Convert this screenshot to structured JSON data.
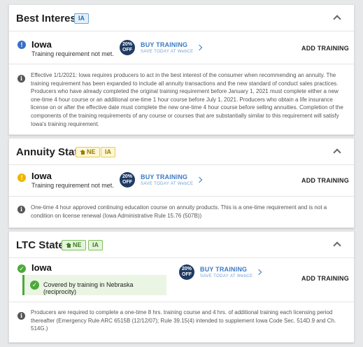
{
  "sections": [
    {
      "title": "Best Interest",
      "tags": [
        {
          "label": "IA",
          "color": "blue"
        }
      ],
      "state": "Iowa",
      "status": "error",
      "message": "Training requirement not met.",
      "badge_line1": "20%",
      "badge_line2": "OFF",
      "buy_title": "BUY TRAINING",
      "buy_sub": "SAVE TODAY AT WebCE",
      "add_label": "ADD TRAINING",
      "info": "Effective 1/1/2021: Iowa requires producers to act in the best interest of the consumer when recommending an annuity. The training requirement has been expanded to include all annuity transactions and the new standard of conduct sales practices. Producers who have already completed the original training requirement before January 1, 2021 must complete either a new one-time 4 hour course or an additional one-time 1 hour course before July 1, 2021. Producers who obtain a life insurance license on or after the effective date must complete the new one-time 4 hour course before selling annuities. Completion of the components of the training requirements of any course or courses that are substantially similar to this requirement will satisfy Iowa's training requirement."
    },
    {
      "title": "Annuity State",
      "tags": [
        {
          "label": "NE",
          "color": "yellow",
          "home": true
        },
        {
          "label": "IA",
          "color": "yellow"
        }
      ],
      "state": "Iowa",
      "status": "warning",
      "message": "Training requirement not met.",
      "badge_line1": "20%",
      "badge_line2": "OFF",
      "buy_title": "BUY TRAINING",
      "buy_sub": "SAVE TODAY AT WebCE",
      "add_label": "ADD TRAINING",
      "info": "One-time 4 hour approved continuing education course on annuity products. This is a one-time requirement and is not a condition on license renewal (Iowa Administrative Rule 15.76 (507B))"
    },
    {
      "title": "LTC State",
      "tags": [
        {
          "label": "NE",
          "color": "green",
          "home": true
        },
        {
          "label": "IA",
          "color": "green"
        }
      ],
      "state": "Iowa",
      "status": "ok",
      "covered": "Covered by training in Nebraska (reciprocity)",
      "badge_line1": "20%",
      "badge_line2": "OFF",
      "buy_title": "BUY TRAINING",
      "buy_sub": "SAVE TODAY AT WebCE",
      "add_label": "ADD TRAINING",
      "info": "Producers are required to complete a one-time 8 hrs. training course and 4 hrs. of additional training each licensing period thereafter (Emergency Rule ARC 6515B (12/12/07); Rule 39.15(4) intended to supplement Iowa Code Sec. 514D.9 and Ch. 514G.)"
    }
  ],
  "colors": {
    "error": "#3a6fc4",
    "warning": "#f0b400",
    "ok": "#4ca93a",
    "badge": "#1f3b63",
    "link": "#3a79c4"
  },
  "icons": {
    "error": "exclamation-icon",
    "warning": "exclamation-icon",
    "ok": "check-icon",
    "info": "info-icon",
    "collapse": "chevron-up-icon",
    "home": "home-icon",
    "arrow": "chevron-right-icon"
  }
}
